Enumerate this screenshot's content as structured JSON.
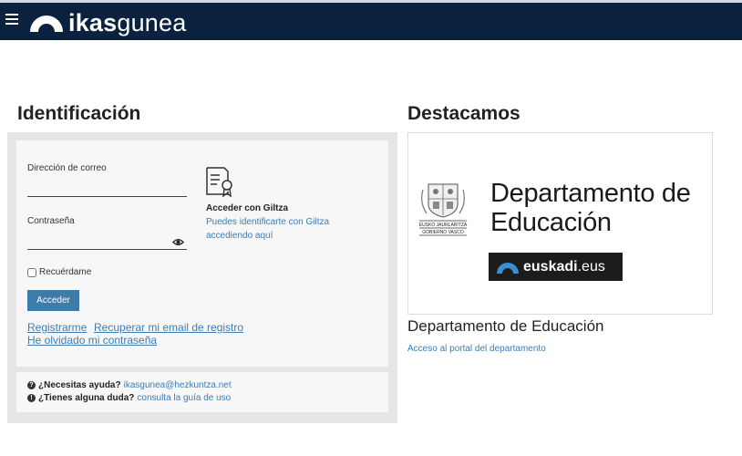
{
  "header": {
    "brand_bold": "ikas",
    "brand_light": "gunea"
  },
  "login": {
    "title": "Identificación",
    "email_label": "Dirección de correo",
    "email_value": "",
    "password_label": "Contraseña",
    "password_value": "",
    "remember_label": "Recuérdame",
    "submit_label": "Acceder",
    "register_link": "Registrarme",
    "recover_email_link": "Recuperar mi email de registro",
    "forgot_password_link": "He olvidado mi contraseña"
  },
  "giltza": {
    "title": "Acceder con Giltza",
    "description": "Puedes identificarte con Giltza accediendo aquí"
  },
  "help": {
    "need_help_label": "¿Necesitas ayuda?",
    "need_help_email": "ikasgunea@hezkuntza.net",
    "doubt_label": "¿Tienes alguna duda?",
    "doubt_link": "consulta la guía de uso"
  },
  "featured": {
    "title": "Destacamos",
    "banner_line1": "Departamento de",
    "banner_line2": "Educación",
    "banner_seal_text_1": "EUSKO JAURLARITZA",
    "banner_seal_text_2": "GOBIERNO VASCO",
    "euskadi_bold": "euskadi",
    "euskadi_light": ".eus",
    "dept_title": "Departamento de Educación",
    "dept_link": "Acceso al portal del departamento"
  },
  "colors": {
    "navbar": "#0a2240",
    "link": "#3c7db4",
    "button": "#3e7ca8"
  }
}
